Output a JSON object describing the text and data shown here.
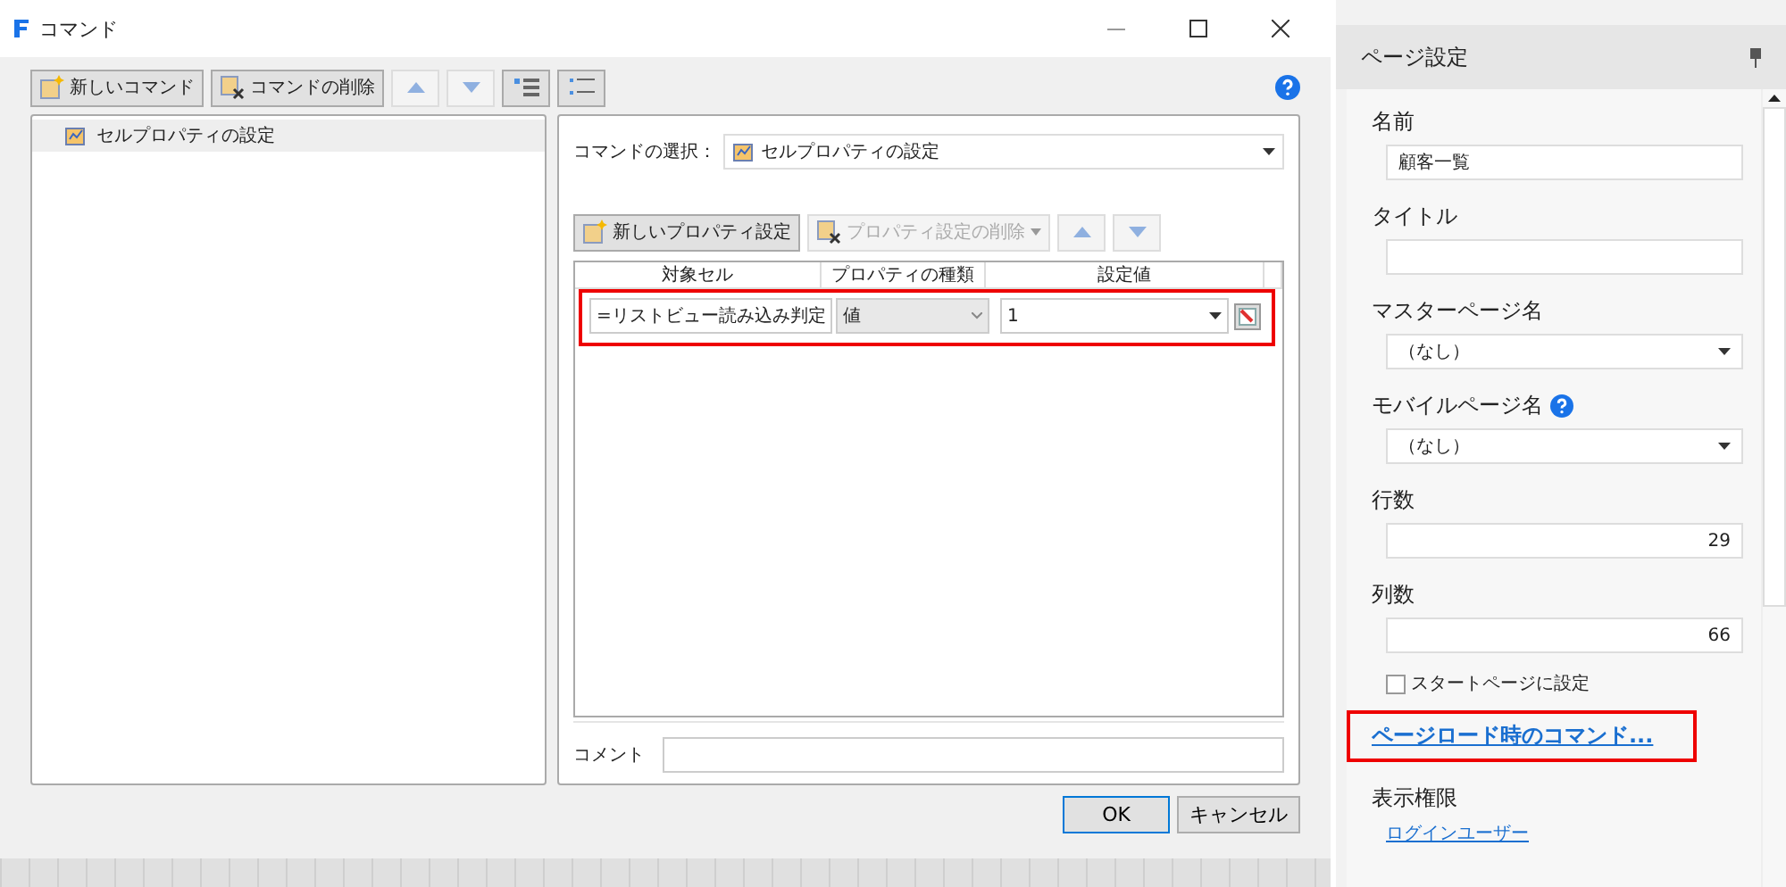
{
  "window": {
    "title": "コマンド"
  },
  "toolbar": [
    {
      "kind": "new",
      "label": "新しいコマンド",
      "disabled": false
    },
    {
      "kind": "delete",
      "label": "コマンドの削除",
      "disabled": false
    },
    {
      "kind": "up",
      "disabled": true
    },
    {
      "kind": "down",
      "disabled": true
    },
    {
      "kind": "expand",
      "disabled": false
    },
    {
      "kind": "collapse",
      "disabled": false
    }
  ],
  "command_tree": {
    "items": [
      {
        "label": "セルプロパティの設定",
        "selected": true
      }
    ]
  },
  "command_select": {
    "label": "コマンドの選択：",
    "value": "セルプロパティの設定"
  },
  "property_toolbar": [
    {
      "kind": "new",
      "label": "新しいプロパティ設定",
      "disabled": false
    },
    {
      "kind": "delete",
      "label": "プロパティ設定の削除",
      "disabled": true
    },
    {
      "kind": "up",
      "disabled": true
    },
    {
      "kind": "down",
      "disabled": true
    }
  ],
  "property_table": {
    "columns": [
      "対象セル",
      "プロパティの種類",
      "設定値"
    ],
    "rows": [
      {
        "target": "=リストビュー読み込み判定",
        "type": "値",
        "value": "1",
        "highlighted": true
      }
    ]
  },
  "comment": {
    "label": "コメント"
  },
  "buttons": [
    {
      "label": "OK",
      "default": true
    },
    {
      "label": "キャンセル",
      "default": false
    }
  ],
  "side_panel": {
    "title": "ページ設定",
    "fields": [
      {
        "kind": "text",
        "label": "名前",
        "value": "顧客一覧"
      },
      {
        "kind": "text",
        "label": "タイトル"
      },
      {
        "kind": "select",
        "label": "マスターページ名",
        "value": "（なし）"
      },
      {
        "kind": "select",
        "label": "モバイルページ名",
        "value": "（なし）",
        "help": true
      },
      {
        "kind": "number",
        "label": "行数",
        "value": "29"
      },
      {
        "kind": "number",
        "label": "列数",
        "value": "66"
      }
    ],
    "start_page": {
      "label": "スタートページに設定",
      "checked": false
    },
    "load_command_link": {
      "label": "ページロード時のコマンド...",
      "highlighted": true
    },
    "permission": {
      "title": "表示権限",
      "link": "ログインユーザー"
    }
  }
}
